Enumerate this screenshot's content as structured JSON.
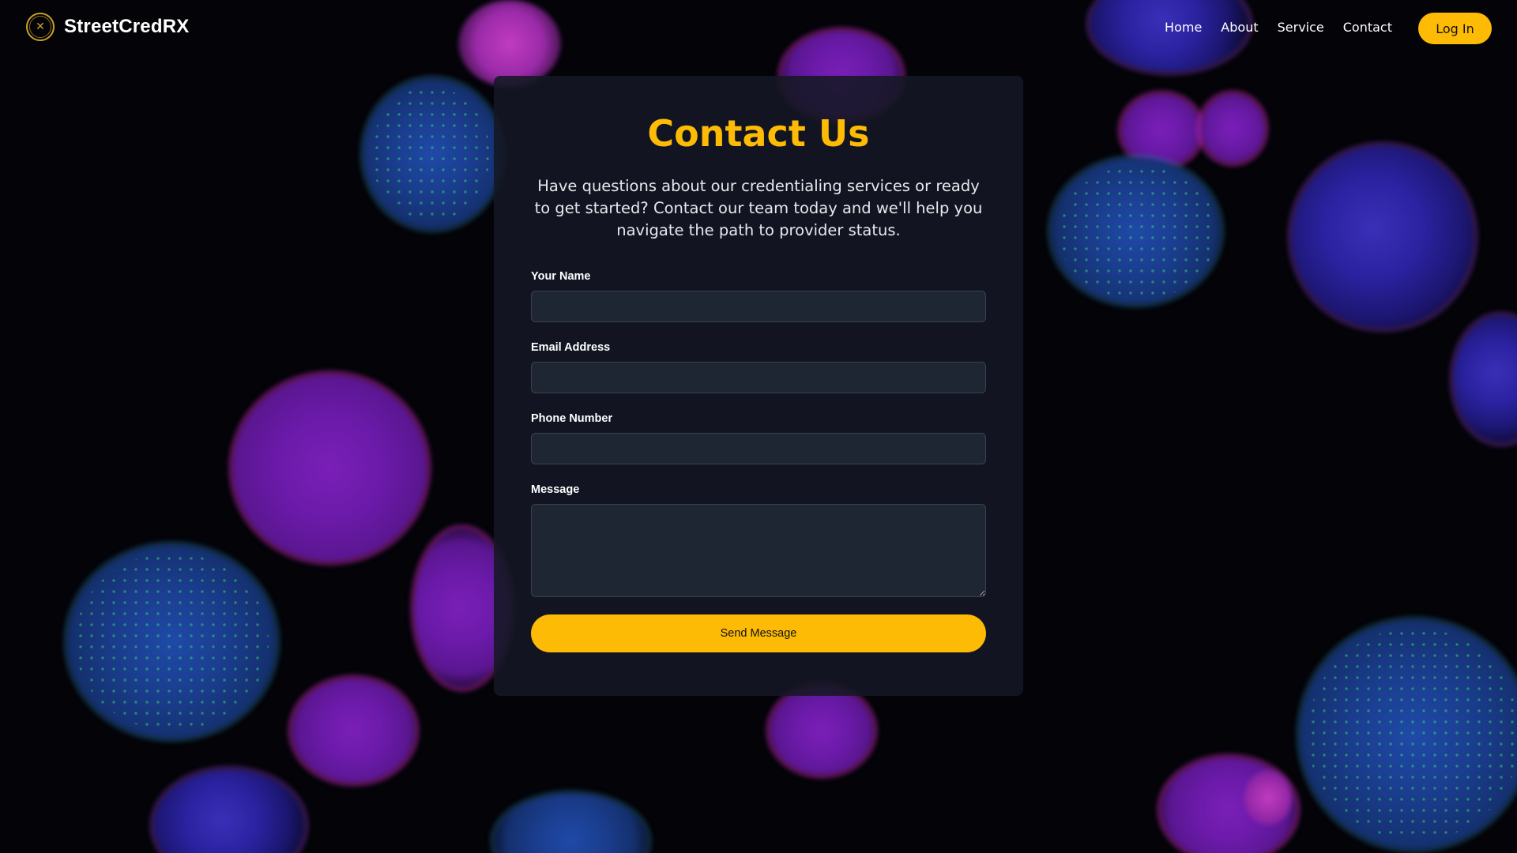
{
  "nav": {
    "brand": "StreetCredRX",
    "links": [
      "Home",
      "About",
      "Service",
      "Contact"
    ],
    "login_label": "Log In"
  },
  "contact": {
    "title": "Contact Us",
    "description": "Have questions about our credentialing services or ready to get started? Contact our team today and we'll help you navigate the path to provider status.",
    "fields": {
      "name": {
        "label": "Your Name",
        "value": ""
      },
      "email": {
        "label": "Email Address",
        "value": ""
      },
      "phone": {
        "label": "Phone Number",
        "value": ""
      },
      "message": {
        "label": "Message",
        "value": ""
      }
    },
    "submit_label": "Send Message"
  },
  "colors": {
    "accent": "#fdbb06",
    "card_bg": "#141824",
    "input_bg": "#1f2633",
    "page_bg": "#030308"
  },
  "icons": {
    "logo": "crosshair-circle-logo-icon"
  }
}
